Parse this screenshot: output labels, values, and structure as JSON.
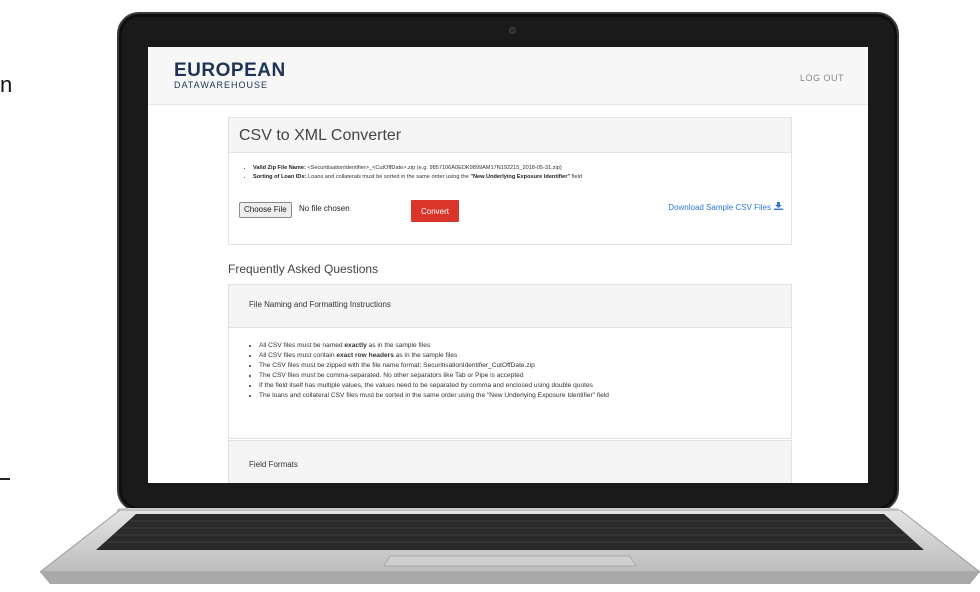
{
  "app": {
    "logo_line1": "EUROPEAN",
    "logo_line2": "DATAWAREHOUSE",
    "logout_label": "LOG OUT"
  },
  "converter": {
    "title": "CSV to XML Converter",
    "rule1_label": "Valid Zip File Name:",
    "rule1_text": "<SecuritisationIdentifier>_<CutOffDate>.zip (e.g. 9857106A0EDK9899AM17N192215_2018-05-31.zip)",
    "rule2_label": "Sorting of Loan IDs:",
    "rule2_text_pre": "Loans and collaterals must be sorted in the same order using the ",
    "rule2_bold": "\"New Underlying Exposure Identifier\"",
    "rule2_text_post": " field",
    "choose_file_label": "Choose File",
    "no_file_text": "No file chosen",
    "convert_label": "Convert",
    "download_label": "Download Sample CSV Files"
  },
  "faq": {
    "heading": "Frequently Asked Questions",
    "sections": [
      {
        "title": "File Naming and Formatting Instructions",
        "items": [
          {
            "pre": "All CSV files must be named ",
            "bold": "exactly",
            "post": " as in the sample files"
          },
          {
            "pre": "All CSV files must contain ",
            "bold": "exact row headers",
            "post": " as in the sample files"
          },
          {
            "pre": "The CSV files must be zipped with the file name format: SecuritisationIdentifier_CutOffDate.zip",
            "bold": "",
            "post": ""
          },
          {
            "pre": "The CSV files must be comma-separated. No other separators like Tab or Pipe is accepted",
            "bold": "",
            "post": ""
          },
          {
            "pre": "If the field itself has multiple values, the values need to be separated by comma and enclosed using double quotes",
            "bold": "",
            "post": ""
          },
          {
            "pre": "The loans and collateral CSV files must be sorted in the same order using the \"New Underlying Exposure Identifier\" field",
            "bold": "",
            "post": ""
          }
        ]
      },
      {
        "title": "Field Formats"
      }
    ]
  },
  "page_fragments": {
    "left_letter": "n"
  },
  "colors": {
    "brand": "#1e3456",
    "accent": "#d9352a",
    "link": "#2f7ad8"
  }
}
